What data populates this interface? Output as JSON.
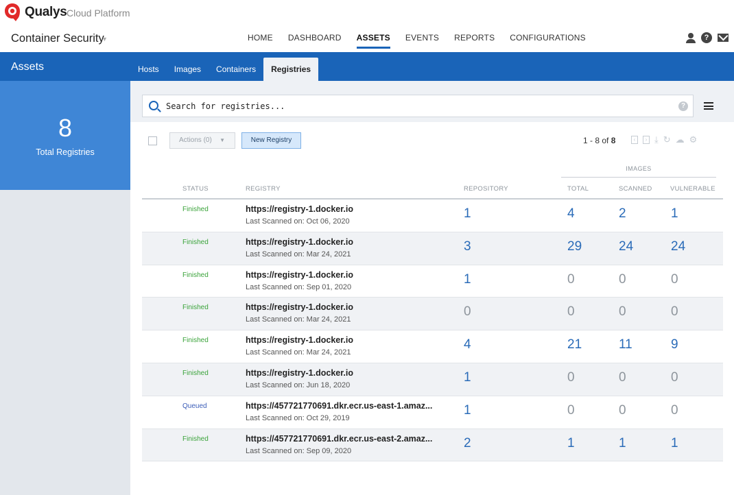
{
  "brand": {
    "name": "Qualys",
    "product": "Cloud Platform"
  },
  "app": {
    "title": "Container Security"
  },
  "nav": [
    {
      "label": "HOME",
      "active": false
    },
    {
      "label": "DASHBOARD",
      "active": false
    },
    {
      "label": "ASSETS",
      "active": true
    },
    {
      "label": "EVENTS",
      "active": false
    },
    {
      "label": "REPORTS",
      "active": false
    },
    {
      "label": "CONFIGURATIONS",
      "active": false
    }
  ],
  "section": {
    "title": "Assets"
  },
  "subtabs": [
    {
      "label": "Hosts",
      "active": false
    },
    {
      "label": "Images",
      "active": false
    },
    {
      "label": "Containers",
      "active": false
    },
    {
      "label": "Registries",
      "active": true
    }
  ],
  "stat": {
    "value": "8",
    "label": "Total Registries"
  },
  "search": {
    "placeholder": "Search for registries...",
    "help": "?"
  },
  "toolbar": {
    "actions_label": "Actions (0)",
    "new_label": "New Registry"
  },
  "pager": {
    "range": "1 - 8 of",
    "total": "8"
  },
  "table": {
    "group_header": "IMAGES",
    "headers": {
      "status": "STATUS",
      "registry": "REGISTRY",
      "repository": "REPOSITORY",
      "total": "TOTAL",
      "scanned": "SCANNED",
      "vulnerable": "VULNERABLE"
    },
    "rows": [
      {
        "status": "Finished",
        "registry": "https://registry-1.docker.io",
        "scanned_on": "Last Scanned on: Oct 06, 2020",
        "repository": "1",
        "total": "4",
        "scanned": "2",
        "vulnerable": "1"
      },
      {
        "status": "Finished",
        "registry": "https://registry-1.docker.io",
        "scanned_on": "Last Scanned on: Mar 24, 2021",
        "repository": "3",
        "total": "29",
        "scanned": "24",
        "vulnerable": "24"
      },
      {
        "status": "Finished",
        "registry": "https://registry-1.docker.io",
        "scanned_on": "Last Scanned on: Sep 01, 2020",
        "repository": "1",
        "total": "0",
        "scanned": "0",
        "vulnerable": "0"
      },
      {
        "status": "Finished",
        "registry": "https://registry-1.docker.io",
        "scanned_on": "Last Scanned on: Mar 24, 2021",
        "repository": "0",
        "total": "0",
        "scanned": "0",
        "vulnerable": "0"
      },
      {
        "status": "Finished",
        "registry": "https://registry-1.docker.io",
        "scanned_on": "Last Scanned on: Mar 24, 2021",
        "repository": "4",
        "total": "21",
        "scanned": "11",
        "vulnerable": "9"
      },
      {
        "status": "Finished",
        "registry": "https://registry-1.docker.io",
        "scanned_on": "Last Scanned on: Jun 18, 2020",
        "repository": "1",
        "total": "0",
        "scanned": "0",
        "vulnerable": "0"
      },
      {
        "status": "Queued",
        "registry": "https://457721770691.dkr.ecr.us-east-1.amaz...",
        "scanned_on": "Last Scanned on: Oct 29, 2019",
        "repository": "1",
        "total": "0",
        "scanned": "0",
        "vulnerable": "0"
      },
      {
        "status": "Finished",
        "registry": "https://457721770691.dkr.ecr.us-east-2.amaz...",
        "scanned_on": "Last Scanned on: Sep 09, 2020",
        "repository": "2",
        "total": "1",
        "scanned": "1",
        "vulnerable": "1"
      }
    ]
  },
  "colors": {
    "primary": "#1a64b8",
    "stat_card": "#3f86d6",
    "finished": "#3aa33a",
    "queued": "#3b5db8",
    "number": "#2a6bb8"
  }
}
